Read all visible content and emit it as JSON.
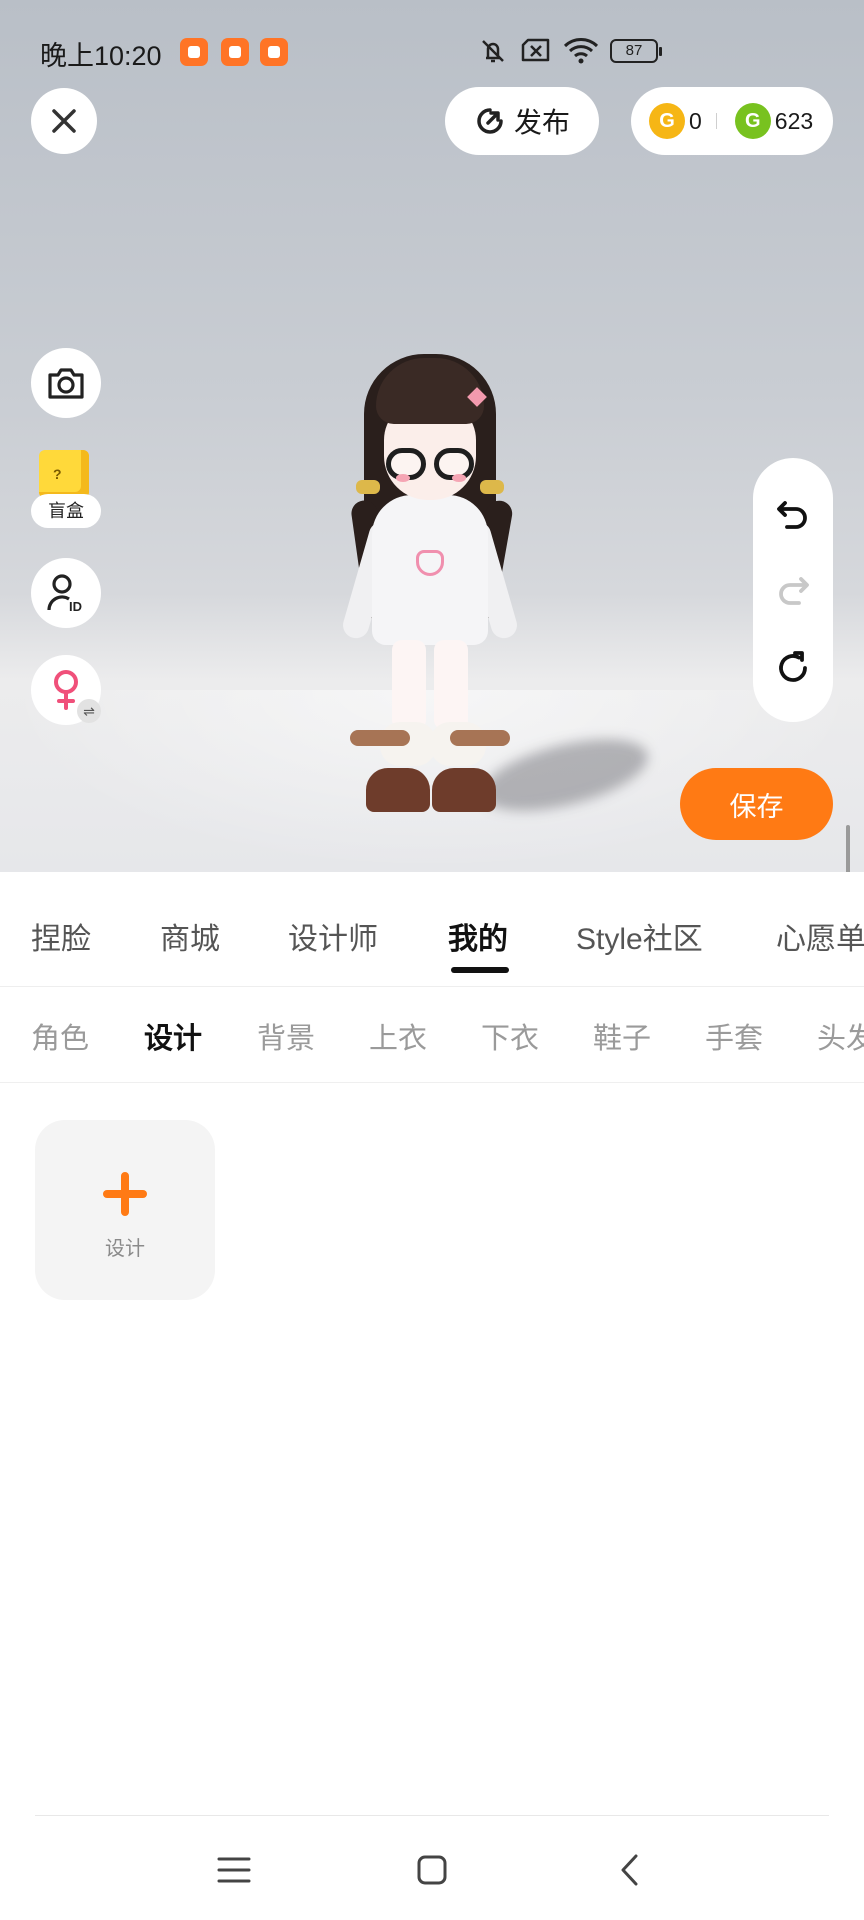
{
  "status_bar": {
    "time": "晚上10:20",
    "battery": "87",
    "app_icon_color": "#ff7426"
  },
  "topbar": {
    "publish_label": "发布",
    "gold_coins": "0",
    "green_coins": "623"
  },
  "left_tools": {
    "blind_box_label": "盲盒"
  },
  "save_label": "保存",
  "main_tabs": [
    {
      "label": "捏脸",
      "active": false
    },
    {
      "label": "商城",
      "active": false
    },
    {
      "label": "设计师",
      "active": false
    },
    {
      "label": "我的",
      "active": true
    },
    {
      "label": "Style社区",
      "active": false
    },
    {
      "label": "心愿单",
      "active": false
    }
  ],
  "sub_tabs": [
    {
      "label": "角色",
      "active": false
    },
    {
      "label": "设计",
      "active": true
    },
    {
      "label": "背景",
      "active": false
    },
    {
      "label": "上衣",
      "active": false
    },
    {
      "label": "下衣",
      "active": false
    },
    {
      "label": "鞋子",
      "active": false
    },
    {
      "label": "手套",
      "active": false
    },
    {
      "label": "头发",
      "active": false
    }
  ],
  "design_card": {
    "label": "设计"
  },
  "colors": {
    "accent": "#ff7a14",
    "gold_coin": "#f6b615",
    "green_coin": "#78c21f"
  }
}
